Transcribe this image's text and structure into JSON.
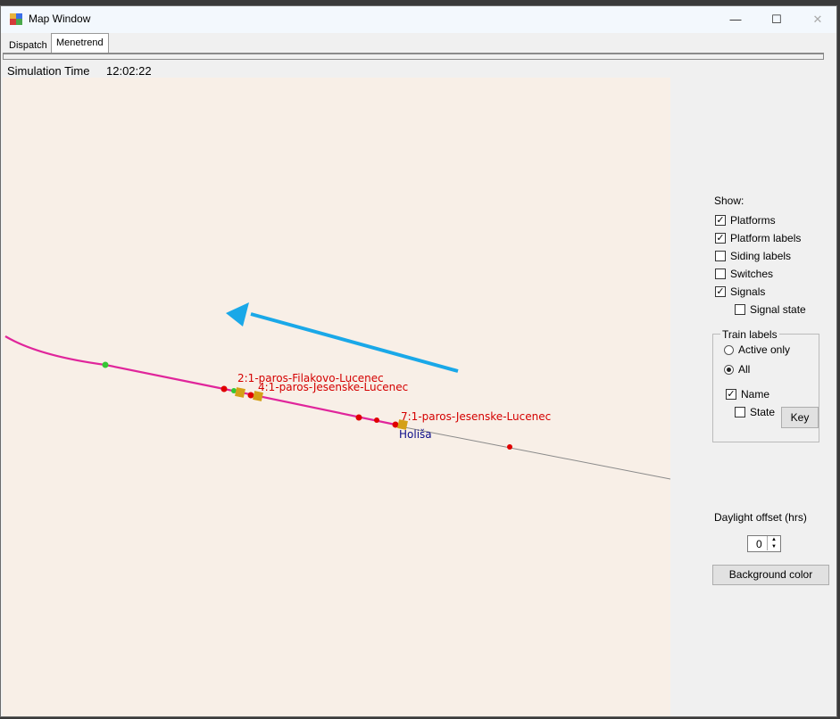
{
  "window": {
    "title": "Map Window",
    "minimize": "—",
    "maximize": "☐",
    "close": "✕"
  },
  "tabs": [
    "Dispatch",
    "Menetrend"
  ],
  "simulation": {
    "label": "Simulation Time",
    "time": "12:02:22"
  },
  "show_panel": {
    "heading": "Show:",
    "options": [
      {
        "label": "Platforms",
        "checked": true
      },
      {
        "label": "Platform labels",
        "checked": true
      },
      {
        "label": "Siding labels",
        "checked": false
      },
      {
        "label": "Switches",
        "checked": false
      },
      {
        "label": "Signals",
        "checked": true
      },
      {
        "label": "Signal state",
        "checked": false
      }
    ]
  },
  "train_labels": {
    "title": "Train labels",
    "radio": [
      {
        "label": "Active only",
        "selected": false
      },
      {
        "label": "All",
        "selected": true
      }
    ],
    "name": {
      "label": "Name",
      "checked": true
    },
    "state": {
      "label": "State",
      "checked": false
    },
    "key_button": "Key"
  },
  "daylight": {
    "label": "Daylight offset (hrs)",
    "value": "0"
  },
  "background_button": "Background color",
  "map": {
    "trains": [
      "2:1-paros-Filakovo-Lucenec",
      "4:1-paros-Jesenske-Lucenec",
      "7:1-paros-Jesenske-Lucenec"
    ],
    "station": "Holiša"
  },
  "colors": {
    "track_active": "#e0259b",
    "track_inactive": "#8a8a8a",
    "signal": "#e00000",
    "platform_marker": "#34c734",
    "train": "#d4a017",
    "arrow": "#1aa8e8",
    "train_label": "#d40000",
    "station_label": "#0c0c8a"
  }
}
